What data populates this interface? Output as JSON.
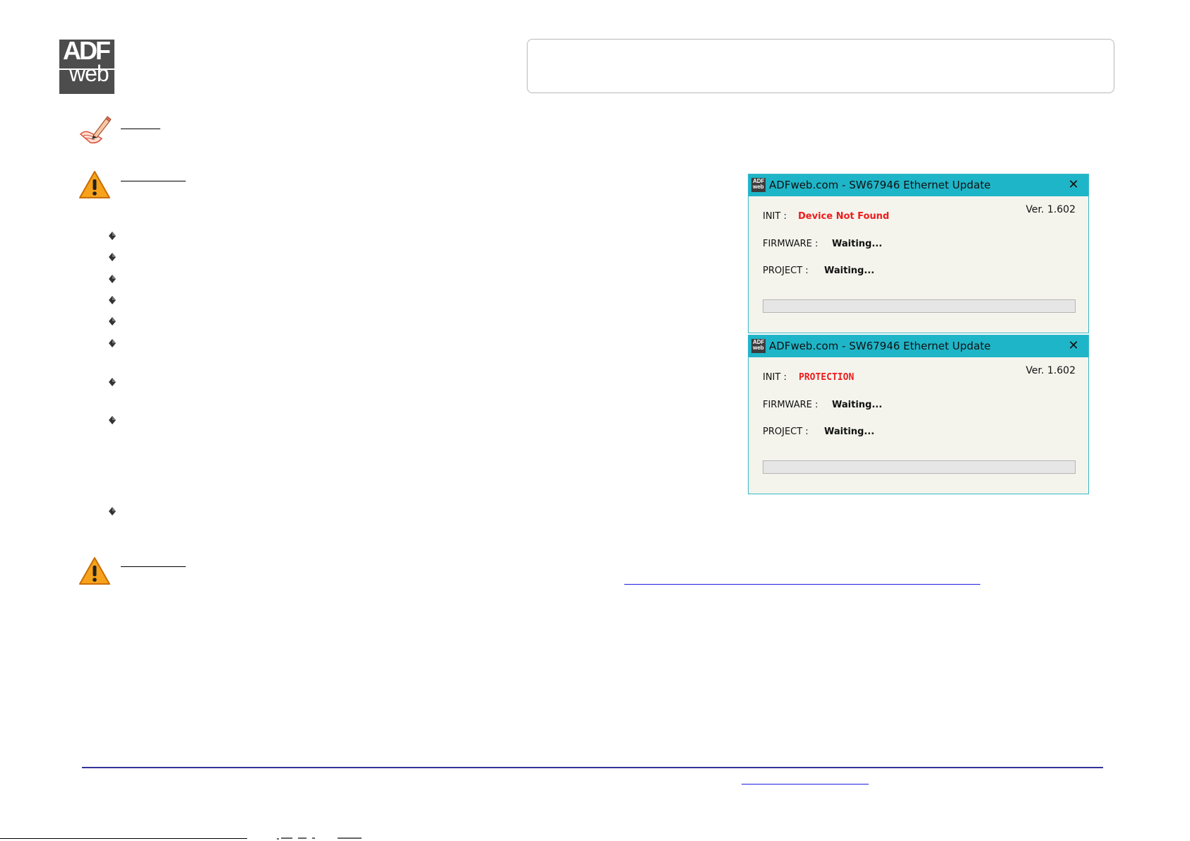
{
  "logo": {
    "top_text": "ADF",
    "bottom_text": "web"
  },
  "icons": {
    "note": "pencil-note-icon",
    "warning": "warning-triangle-icon",
    "bullet": "diamond-bullet-icon",
    "app": "adfweb-app-icon",
    "close": "close-icon"
  },
  "colors": {
    "titlebar": "#1fb5c8",
    "dialog_bg": "#f4f4ed",
    "error_text": "#ee1c1c",
    "warning_fill": "#f7a21b",
    "footer_rule": "#33339a",
    "link": "#1d1de0"
  },
  "dialogs": [
    {
      "title": "ADFweb.com - SW67946 Ethernet Update",
      "close_glyph": "✕",
      "app_icon_text": "ADF web",
      "version": "Ver. 1.602",
      "init_label": "INIT :",
      "init_value": "Device Not Found",
      "firmware_label": "FIRMWARE :",
      "firmware_value": "Waiting...",
      "project_label": "PROJECT :",
      "project_value": "Waiting...",
      "progress": 0
    },
    {
      "title": "ADFweb.com - SW67946 Ethernet Update",
      "close_glyph": "✕",
      "app_icon_text": "ADF web",
      "version": "Ver. 1.602",
      "init_label": "INIT :",
      "init_value": "PROTECTION",
      "firmware_label": "FIRMWARE :",
      "firmware_value": "Waiting...",
      "project_label": "PROJECT :",
      "project_value": "Waiting...",
      "progress": 0
    }
  ]
}
